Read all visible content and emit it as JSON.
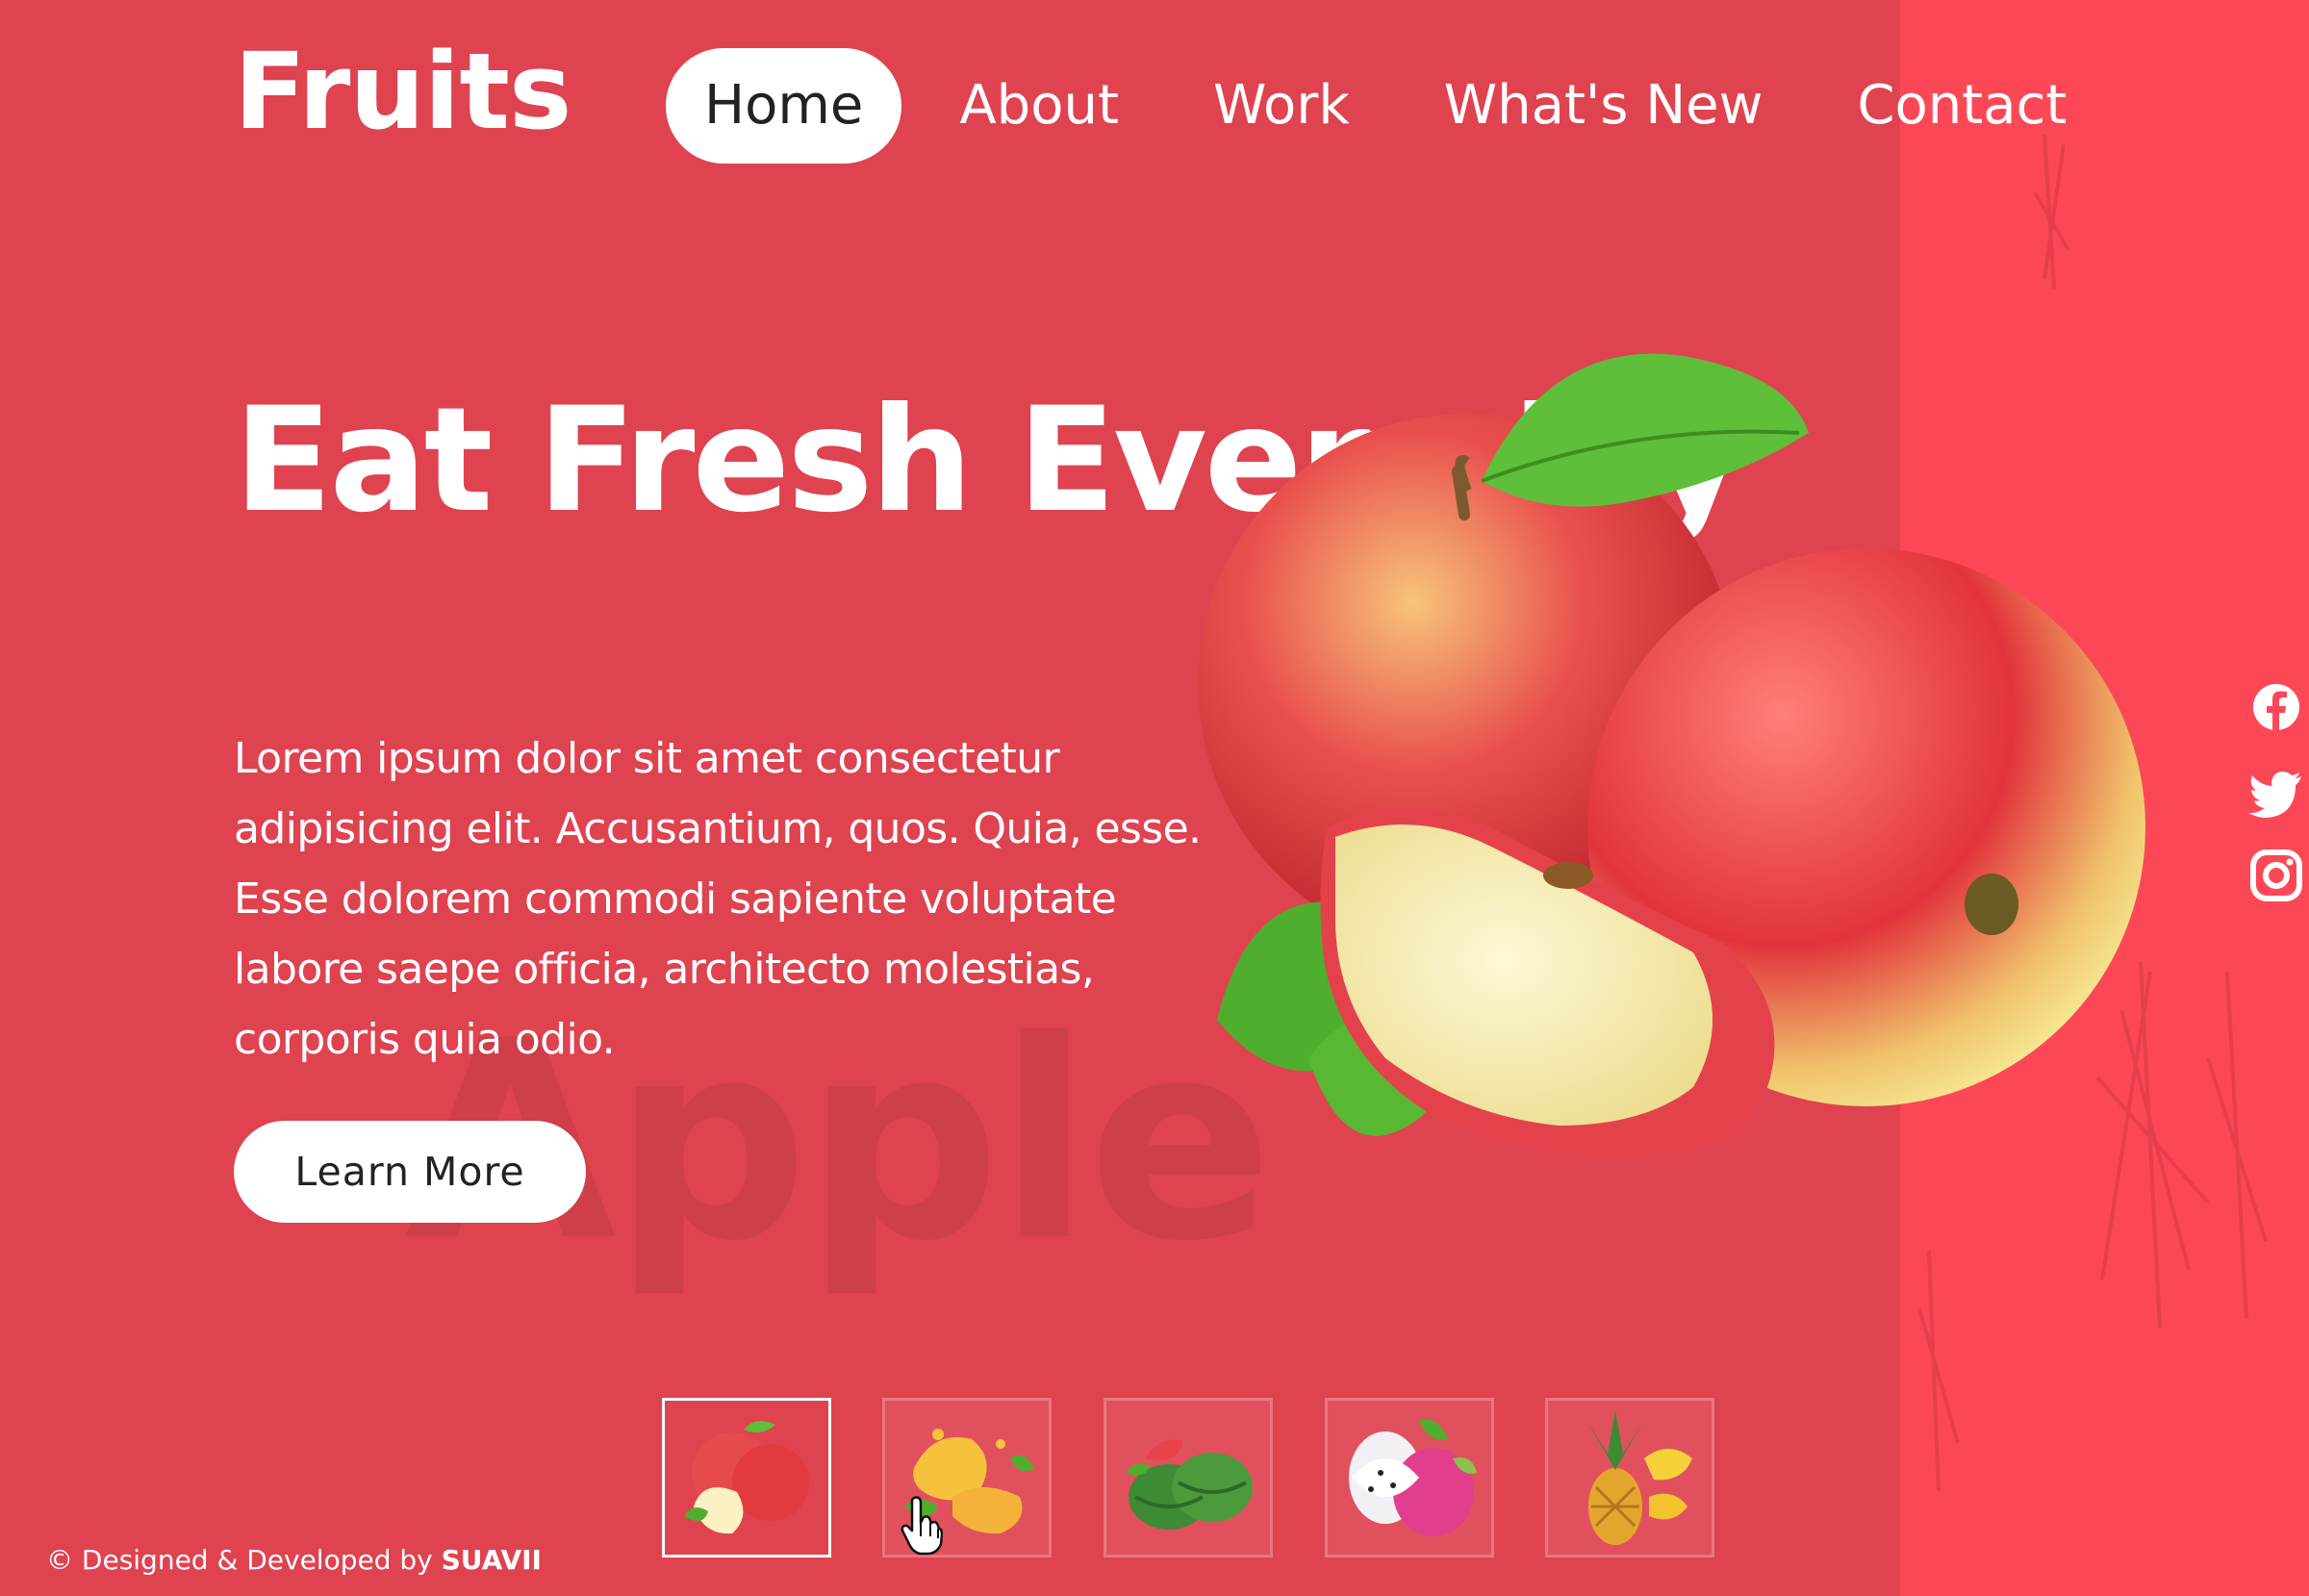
{
  "brand": {
    "logo": "Fruits"
  },
  "nav": {
    "items": [
      {
        "label": "Home",
        "active": true
      },
      {
        "label": "About"
      },
      {
        "label": "Work"
      },
      {
        "label": "What's New"
      },
      {
        "label": "Contact"
      }
    ]
  },
  "hero": {
    "headline": "Eat Fresh Everyday",
    "description": "Lorem ipsum dolor sit amet consectetur adipisicing elit. Accusantium, quos. Quia, esse. Esse dolorem commodi sapiente voluptate labore saepe officia, architecto molestias, corporis quia odio.",
    "button": "Learn More",
    "watermark": "Apple"
  },
  "social": [
    "facebook-icon",
    "twitter-icon",
    "instagram-icon"
  ],
  "thumbnails": [
    {
      "fruit": "apple",
      "active": true
    },
    {
      "fruit": "mango"
    },
    {
      "fruit": "watermelon"
    },
    {
      "fruit": "dragon-fruit"
    },
    {
      "fruit": "pineapple"
    }
  ],
  "footer": {
    "prefix": "© Designed & Developed by",
    "author": "SUAVII"
  },
  "colors": {
    "background": "#df4350",
    "side_panel": "#fc4856",
    "button": "#ffffff",
    "button_text": "#222222"
  }
}
